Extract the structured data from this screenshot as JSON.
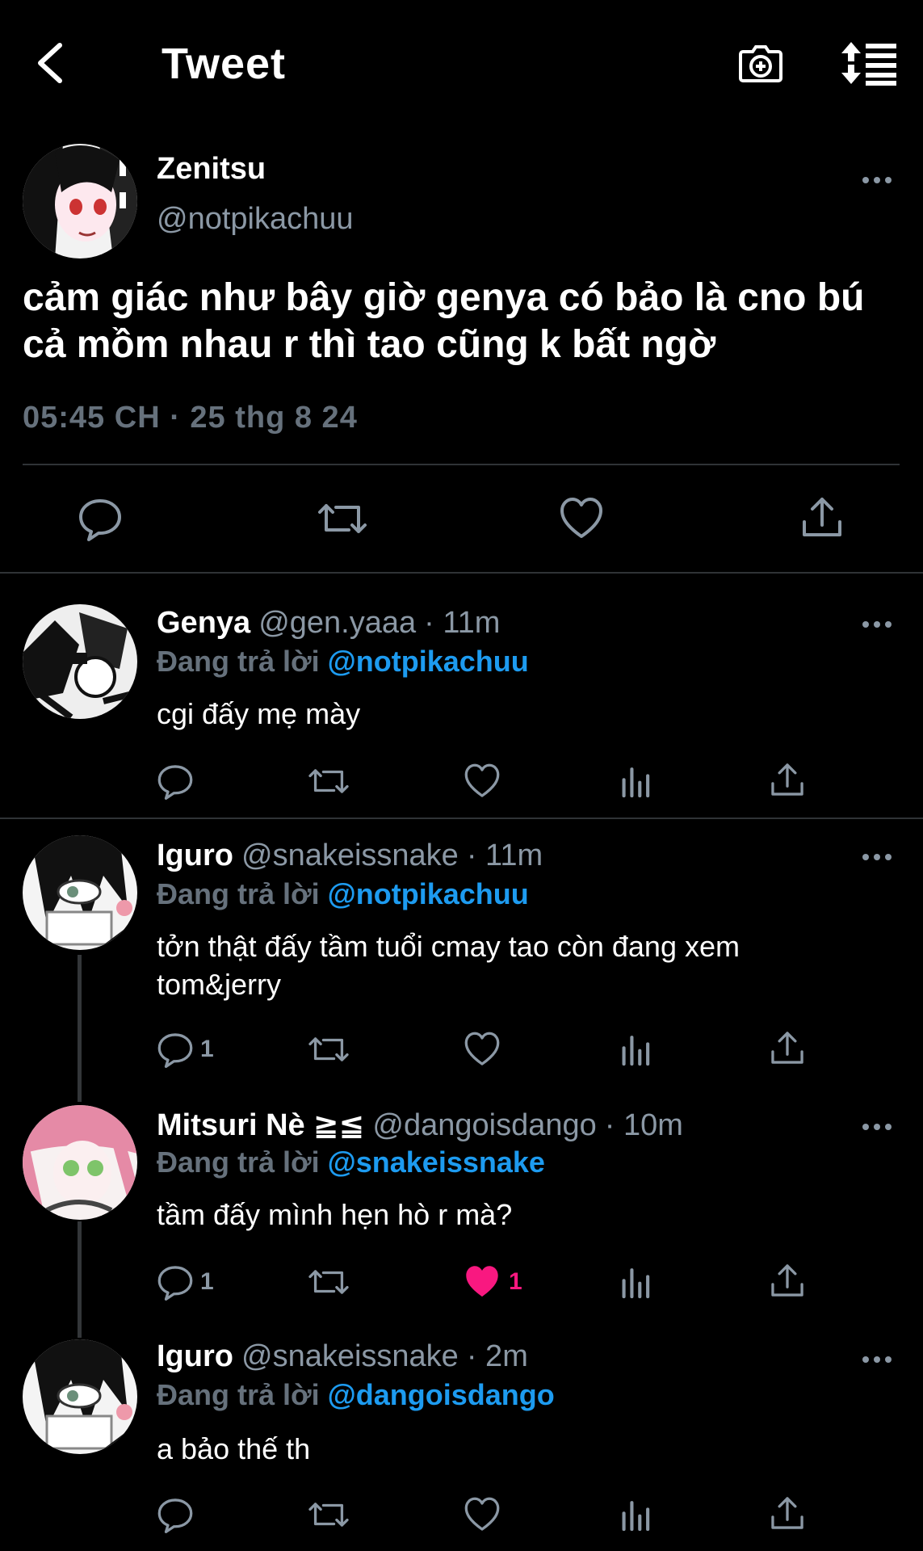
{
  "header": {
    "title": "Tweet"
  },
  "main_tweet": {
    "name": "Zenitsu",
    "handle": "@notpikachuu",
    "text": "cảm giác như bây giờ genya có bảo là cno bú cả mồm nhau r thì tao cũng k bất ngờ",
    "timestamp": "05:45 CH · 25 thg 8 24"
  },
  "replies": [
    {
      "name": "Genya",
      "handle": "@gen.yaaa",
      "time": "· 11m",
      "reply_prefix": "Đang trả lời",
      "mention": "@notpikachuu",
      "text": "cgi đấy mẹ mày",
      "reply_count": "",
      "like_count": ""
    },
    {
      "name": "Iguro",
      "handle": "@snakeissnake",
      "time": "· 11m",
      "reply_prefix": "Đang trả lời",
      "mention": "@notpikachuu",
      "text": "tởn thật đấy tầm tuổi cmay tao còn đang xem tom&jerry",
      "reply_count": "1",
      "like_count": ""
    },
    {
      "name": "Mitsuri Nè",
      "name_suffix": "≧≦",
      "handle": "@dangoisdango",
      "time": "· 10m",
      "reply_prefix": "Đang trả lời",
      "mention": "@snakeissnake",
      "text": "tầm đấy mình hẹn hò r mà?",
      "reply_count": "1",
      "like_count": "1"
    },
    {
      "name": "Iguro",
      "handle": "@snakeissnake",
      "time": "· 2m",
      "reply_prefix": "Đang trả lời",
      "mention": "@dangoisdango",
      "text": "a bảo thế th",
      "reply_count": "",
      "like_count": ""
    }
  ],
  "colors": {
    "accent": "#1d9bf0",
    "like": "#f91880",
    "muted": "#8b98a5",
    "background": "#000000"
  }
}
